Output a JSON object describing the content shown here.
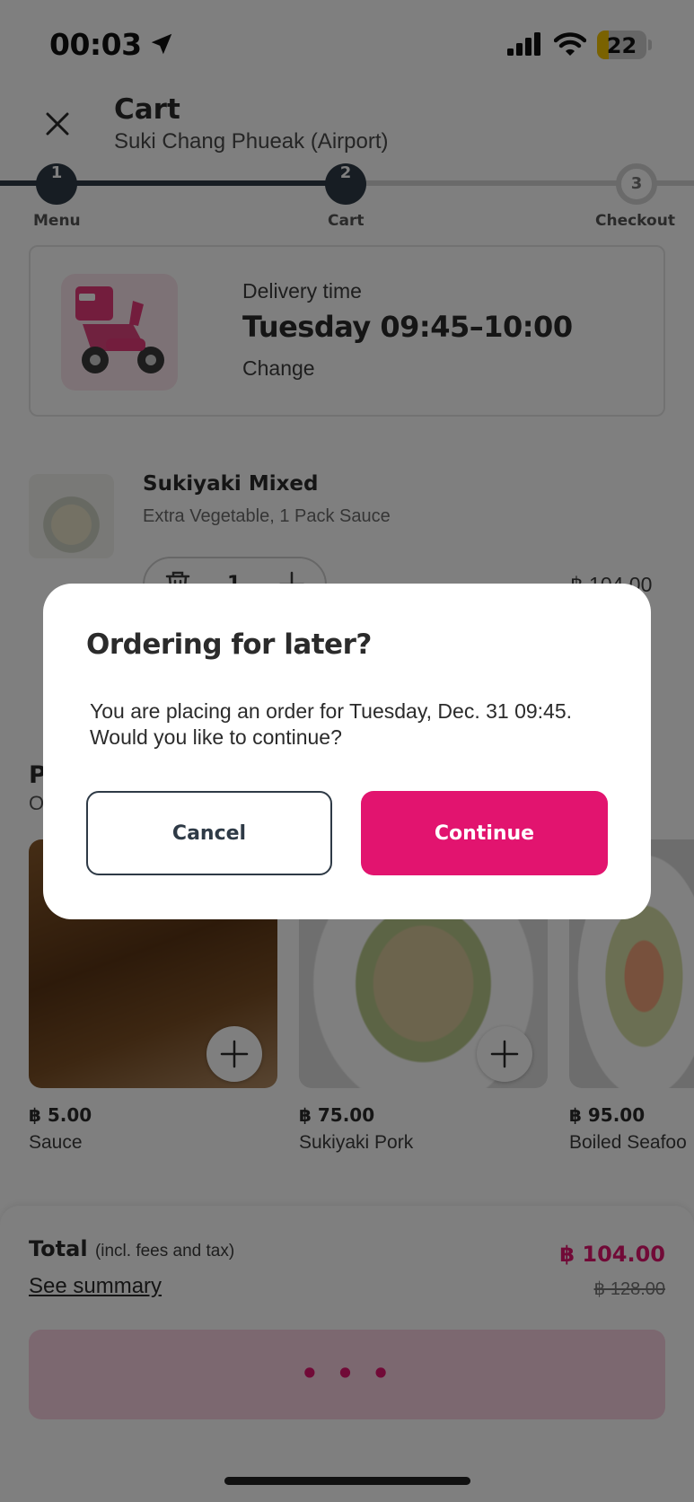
{
  "status_bar": {
    "time": "00:03",
    "battery": "22"
  },
  "header": {
    "title": "Cart",
    "restaurant": "Suki Chang Phueak (Airport)"
  },
  "steps": [
    {
      "number": "1",
      "label": "Menu"
    },
    {
      "number": "2",
      "label": "Cart"
    },
    {
      "number": "3",
      "label": "Checkout"
    }
  ],
  "delivery": {
    "label": "Delivery time",
    "time": "Tuesday 09:45–10:00",
    "change": "Change"
  },
  "cart_item": {
    "name": "Sukiyaki Mixed",
    "options": "Extra Vegetable, 1 Pack Sauce",
    "quantity": "1",
    "price": "฿ 104.00"
  },
  "popular": {
    "title": "P",
    "subtitle": "O",
    "products": [
      {
        "price": "฿ 5.00",
        "name": "Sauce"
      },
      {
        "price": "฿ 75.00",
        "name": "Sukiyaki Pork"
      },
      {
        "price": "฿ 95.00",
        "name": "Boiled Seafoo"
      }
    ]
  },
  "footer": {
    "total_label": "Total",
    "total_note": "(incl. fees and tax)",
    "see_summary": "See summary",
    "total_price": "฿ 104.00",
    "original_price": "฿ 128.00",
    "button_dots": "• • •"
  },
  "modal": {
    "title": "Ordering for later?",
    "body": "You are placing an order for Tuesday, Dec. 31 09:45. Would you like to continue?",
    "cancel": "Cancel",
    "continue": "Continue"
  },
  "colors": {
    "brand": "#e2146f",
    "stepper_active": "#2e3a46"
  }
}
